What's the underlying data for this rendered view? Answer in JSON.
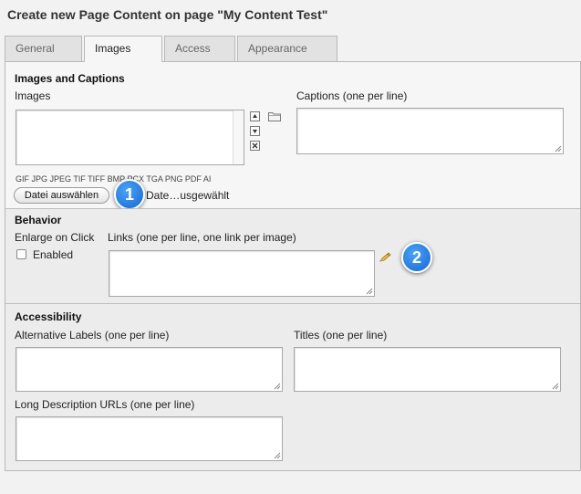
{
  "page_title": "Create new Page Content on page \"My Content Test\"",
  "tabs": [
    {
      "label": "General"
    },
    {
      "label": "Images"
    },
    {
      "label": "Access"
    },
    {
      "label": "Appearance"
    }
  ],
  "images_section": {
    "heading": "Images and Captions",
    "images_label": "Images",
    "captions_label": "Captions (one per line)",
    "file_types": "GIF JPG JPEG TIF TIFF BMP PCX TGA PNG PDF AI",
    "file_button": "Datei auswählen",
    "file_status": "Date…usgewählt"
  },
  "behavior_section": {
    "heading": "Behavior",
    "enlarge_label": "Enlarge on Click",
    "enabled_label": "Enabled",
    "links_label": "Links (one per line, one link per image)"
  },
  "accessibility_section": {
    "heading": "Accessibility",
    "alt_labels_label": "Alternative Labels (one per line)",
    "titles_label": "Titles (one per line)",
    "long_desc_label": "Long Description URLs (one per line)"
  },
  "badges": {
    "one": "1",
    "two": "2"
  },
  "icons": [
    "folder-icon",
    "move-up-icon",
    "move-down-icon",
    "remove-icon",
    "link-wizard-icon",
    "resize-grip-icon"
  ]
}
